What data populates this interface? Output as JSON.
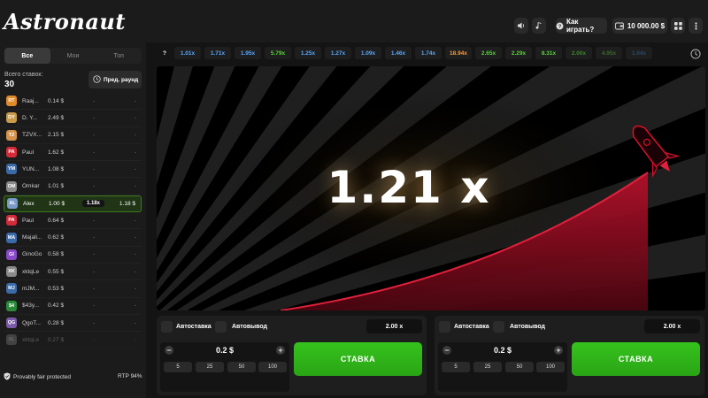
{
  "header": {
    "logo": "Astronaut",
    "how_to_play": "Как играть?",
    "balance": "10 000.00 $"
  },
  "left": {
    "tabs": [
      {
        "label": "Все",
        "active": true
      },
      {
        "label": "Мои",
        "active": false
      },
      {
        "label": "Топ",
        "active": false
      }
    ],
    "total_label": "Всего ставок:",
    "total_value": "30",
    "prev_round": "Пред. раунд",
    "bets": [
      {
        "initials": "RT",
        "color": "#e08a2a",
        "name": "Raaj...",
        "amount": "0.14 $",
        "mult": "-",
        "win": "-"
      },
      {
        "initials": "DY",
        "color": "#c89a4a",
        "name": "D. Y...",
        "amount": "2.49 $",
        "mult": "-",
        "win": "-"
      },
      {
        "initials": "TZ",
        "color": "#d4924a",
        "name": "TZVX...",
        "amount": "2.15 $",
        "mult": "-",
        "win": "-"
      },
      {
        "initials": "PA",
        "color": "#d42a3a",
        "name": "Paul",
        "amount": "1.62 $",
        "mult": "-",
        "win": "-"
      },
      {
        "initials": "YM",
        "color": "#3a6aa8",
        "name": "YUN...",
        "amount": "1.08 $",
        "mult": "-",
        "win": "-"
      },
      {
        "initials": "OM",
        "color": "#8a8a8a",
        "name": "Omkar",
        "amount": "1.01 $",
        "mult": "-",
        "win": "-"
      },
      {
        "initials": "AL",
        "color": "#7a9ac8",
        "name": "Alex",
        "amount": "1.00 $",
        "mult": "1.18x",
        "win": "1.18 $",
        "winner": true
      },
      {
        "initials": "PA",
        "color": "#d42a3a",
        "name": "Paul",
        "amount": "0.64 $",
        "mult": "-",
        "win": "-"
      },
      {
        "initials": "MA",
        "color": "#3a6aa8",
        "name": "Majali...",
        "amount": "0.62 $",
        "mult": "-",
        "win": "-"
      },
      {
        "initials": "GI",
        "color": "#8a4ac8",
        "name": "GinoGo",
        "amount": "0.58 $",
        "mult": "-",
        "win": "-"
      },
      {
        "initials": "XK",
        "color": "#8a8a8a",
        "name": "xktqLe",
        "amount": "0.55 $",
        "mult": "-",
        "win": "-"
      },
      {
        "initials": "MJ",
        "color": "#3a6aa8",
        "name": "mJM...",
        "amount": "0.53 $",
        "mult": "-",
        "win": "-"
      },
      {
        "initials": "$4",
        "color": "#2a8a3a",
        "name": "$43y...",
        "amount": "0.42 $",
        "mult": "-",
        "win": "-"
      },
      {
        "initials": "QG",
        "color": "#7a5aa8",
        "name": "QgoT...",
        "amount": "0.28 $",
        "mult": "-",
        "win": "-"
      },
      {
        "initials": "XL",
        "color": "#8a8a8a",
        "name": "xktqLe",
        "amount": "0.27 $",
        "mult": "-",
        "win": "-",
        "fade": true
      }
    ],
    "fair_label": "Provably fair protected",
    "rtp": "RTP 94%"
  },
  "history": [
    {
      "label": "?",
      "color": "#ffffff"
    },
    {
      "label": "1.01x",
      "color": "#5aa8ff"
    },
    {
      "label": "1.71x",
      "color": "#5aa8ff"
    },
    {
      "label": "1.95x",
      "color": "#5aa8ff"
    },
    {
      "label": "5.79x",
      "color": "#55d935"
    },
    {
      "label": "1.25x",
      "color": "#5aa8ff"
    },
    {
      "label": "1.27x",
      "color": "#5aa8ff"
    },
    {
      "label": "1.09x",
      "color": "#5aa8ff"
    },
    {
      "label": "1.46x",
      "color": "#5aa8ff"
    },
    {
      "label": "1.74x",
      "color": "#5aa8ff"
    },
    {
      "label": "18.94x",
      "color": "#ff9a3a"
    },
    {
      "label": "2.65x",
      "color": "#55d935"
    },
    {
      "label": "2.29x",
      "color": "#55d935"
    },
    {
      "label": "8.31x",
      "color": "#55d935"
    },
    {
      "label": "2.00x",
      "color": "#3a8a2a"
    },
    {
      "label": "4.95x",
      "color": "#3a6a2a"
    },
    {
      "label": "1.04x",
      "color": "#2a4a6a"
    }
  ],
  "game": {
    "multiplier": "1.21 x"
  },
  "panels": [
    {
      "autobet": "Автоставка",
      "autocashout": "Автовывод",
      "target": "2.00 x",
      "stake": "0.2 $",
      "quick": [
        "5",
        "25",
        "50",
        "100"
      ],
      "button": "СТАВКА"
    },
    {
      "autobet": "Автоставка",
      "autocashout": "Автовывод",
      "target": "2.00 x",
      "stake": "0.2 $",
      "quick": [
        "5",
        "25",
        "50",
        "100"
      ],
      "button": "СТАВКА"
    }
  ],
  "colors": {
    "accent_green": "#35c21d",
    "rocket_red": "#c4122a"
  }
}
